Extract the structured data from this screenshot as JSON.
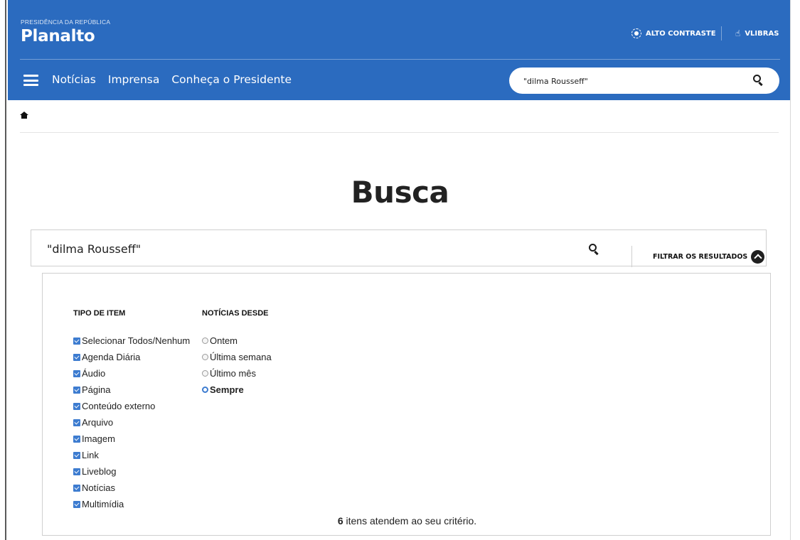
{
  "header": {
    "kicker": "PRESIDÊNCIA DA REPÚBLICA",
    "logo": "Planalto",
    "contrast_label": "ALTO CONTRASTE",
    "vlibras_label": "VLIBRAS",
    "background_color": "#2b6bbf"
  },
  "nav": {
    "items": [
      {
        "label": "Notícias"
      },
      {
        "label": "Imprensa"
      },
      {
        "label": "Conheça o Presidente"
      }
    ]
  },
  "top_search": {
    "value": "\"dilma Rousseff\""
  },
  "page": {
    "title": "Busca"
  },
  "main_search": {
    "value": "\"dilma Rousseff\"",
    "filter_label": "FILTRAR OS RESULTADOS"
  },
  "filters": {
    "type_heading": "TIPO DE ITEM",
    "type_options": [
      {
        "label": "Selecionar Todos/Nenhum",
        "checked": true
      },
      {
        "label": "Agenda Diária",
        "checked": true
      },
      {
        "label": "Áudio",
        "checked": true
      },
      {
        "label": "Página",
        "checked": true
      },
      {
        "label": "Conteúdo externo",
        "checked": true
      },
      {
        "label": "Arquivo",
        "checked": true
      },
      {
        "label": "Imagem",
        "checked": true
      },
      {
        "label": "Link",
        "checked": true
      },
      {
        "label": "Liveblog",
        "checked": true
      },
      {
        "label": "Notícias",
        "checked": true
      },
      {
        "label": "Multimídia",
        "checked": true
      }
    ],
    "date_heading": "NOTÍCIAS DESDE",
    "date_options": [
      {
        "label": "Ontem",
        "checked": false
      },
      {
        "label": "Última semana",
        "checked": false
      },
      {
        "label": "Último mês",
        "checked": false
      },
      {
        "label": "Sempre",
        "checked": true
      }
    ]
  },
  "results": {
    "count": "6",
    "suffix": "itens atendem ao seu critério."
  }
}
